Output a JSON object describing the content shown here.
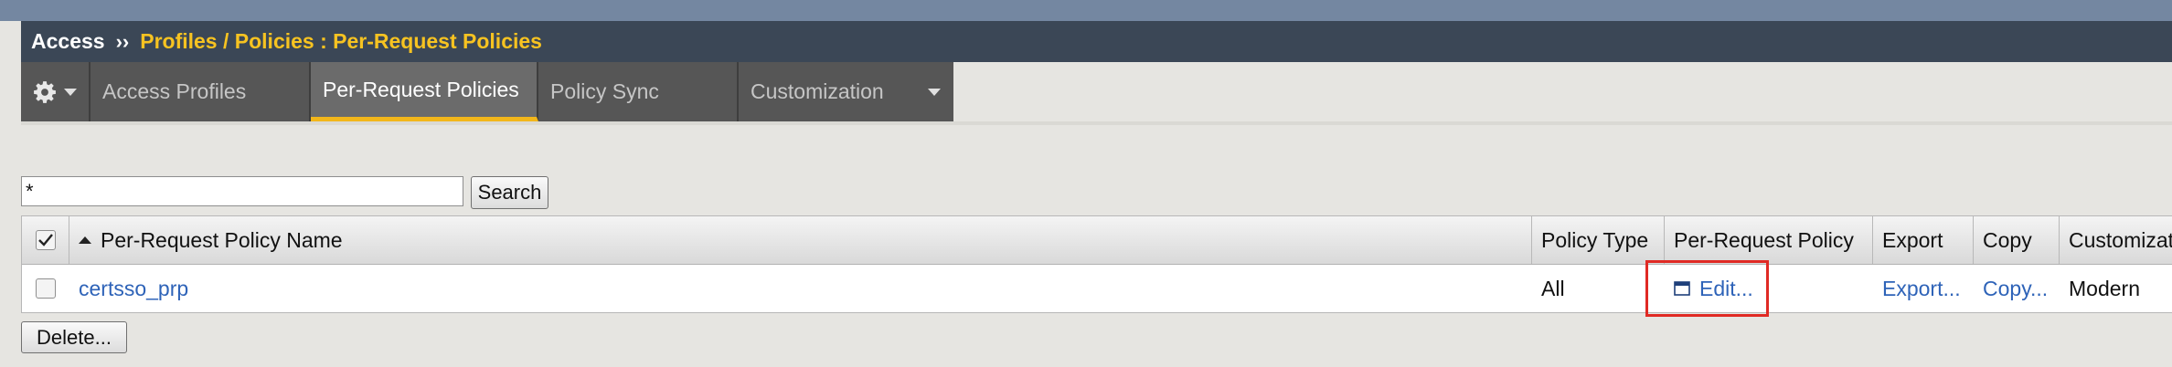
{
  "breadcrumb": {
    "root": "Access",
    "separator": "››",
    "path": "Profiles / Policies : Per-Request Policies"
  },
  "menu": {
    "gear_icon": "gear-icon",
    "tabs": [
      {
        "label": "Access Profiles",
        "active": false
      },
      {
        "label": "Per-Request Policies",
        "active": true
      },
      {
        "label": "Policy Sync",
        "active": false
      },
      {
        "label": "Customization",
        "active": false,
        "has_dropdown": true
      }
    ]
  },
  "search": {
    "value": "*",
    "button_label": "Search"
  },
  "table": {
    "columns": [
      "Per-Request Policy Name",
      "Policy Type",
      "Per-Request Policy",
      "Export",
      "Copy",
      "Customization"
    ],
    "sort_column": "Per-Request Policy Name",
    "sort_direction": "ascending",
    "rows": [
      {
        "name": "certsso_prp",
        "policy_type": "All",
        "edit_link": "Edit...",
        "export_link": "Export...",
        "copy_link": "Copy...",
        "customization": "Modern"
      }
    ]
  },
  "actions": {
    "delete_label": "Delete..."
  },
  "colors": {
    "title_bar": "#3b4756",
    "breadcrumb_path": "#f7c321",
    "active_tab_underline": "#f2b61a",
    "link": "#2e63b8",
    "highlight_box": "#e02a24"
  }
}
